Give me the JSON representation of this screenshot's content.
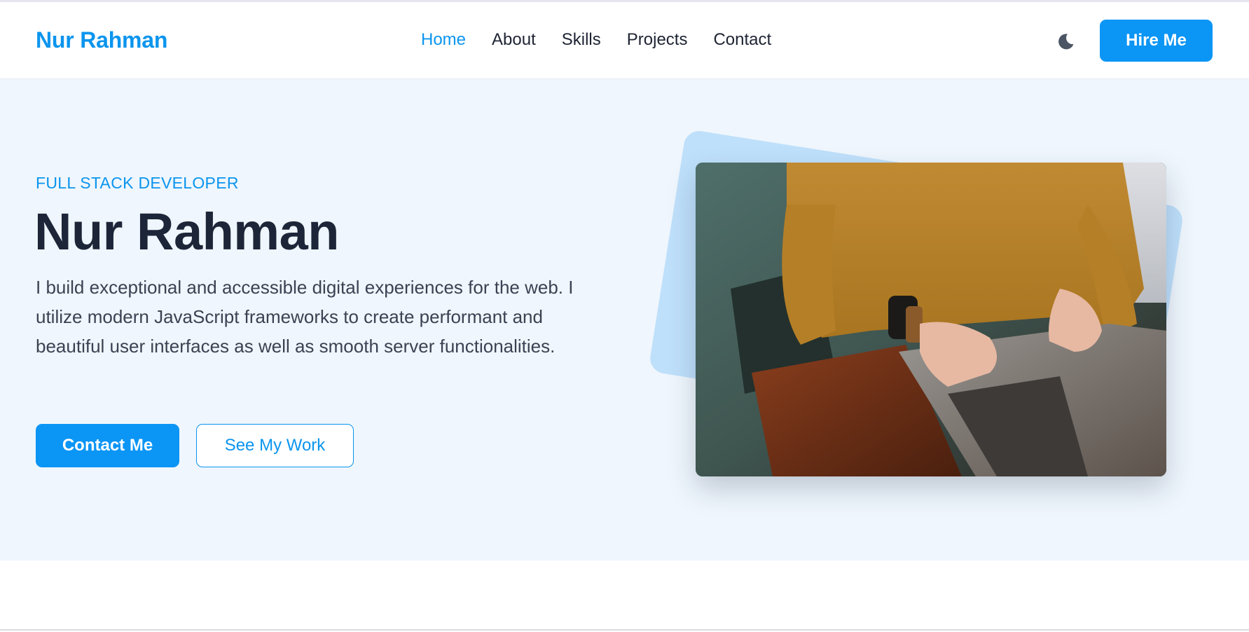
{
  "header": {
    "brand": "Nur Rahman",
    "nav": [
      {
        "label": "Home",
        "active": true
      },
      {
        "label": "About",
        "active": false
      },
      {
        "label": "Skills",
        "active": false
      },
      {
        "label": "Projects",
        "active": false
      },
      {
        "label": "Contact",
        "active": false
      }
    ],
    "theme_toggle_icon": "moon-icon",
    "hire_label": "Hire Me"
  },
  "hero": {
    "role": "FULL STACK DEVELOPER",
    "name": "Nur Rahman",
    "description": "I build exceptional and accessible digital experiences for the web. I utilize modern JavaScript frameworks to create performant and beautiful user interfaces as well as smooth server functionalities.",
    "primary_cta": "Contact Me",
    "secondary_cta": "See My Work"
  },
  "colors": {
    "accent": "#0b95f5",
    "hero_background": "#eff6fd",
    "backdrop": "#bfe0fb",
    "heading": "#1d2638"
  }
}
